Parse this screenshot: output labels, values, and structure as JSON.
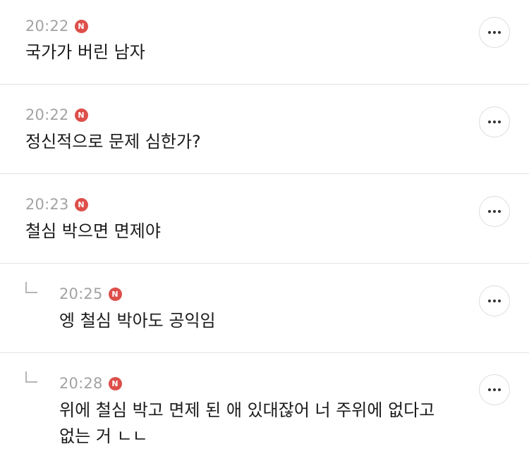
{
  "comments": [
    {
      "time": "20:22",
      "badge": "N",
      "text": "국가가 버린 남자",
      "is_reply": false
    },
    {
      "time": "20:22",
      "badge": "N",
      "text": "정신적으로 문제 심한가?",
      "is_reply": false
    },
    {
      "time": "20:23",
      "badge": "N",
      "text": "철심 박으면 면제야",
      "is_reply": false
    },
    {
      "time": "20:25",
      "badge": "N",
      "text": "엥 철심 박아도 공익임",
      "is_reply": true
    },
    {
      "time": "20:28",
      "badge": "N",
      "text": "위에 철심 박고 면제 된 애 있대잖어 너 주위에 없다고\n없는 거 ㄴㄴ",
      "is_reply": true
    }
  ],
  "icons": {
    "more": "more-options-icon",
    "reply": "reply-arrow-icon"
  },
  "colors": {
    "badge": "#dd4f4a",
    "time": "#a3a3a3",
    "text": "#1b1b1b",
    "divider": "#e3e3e3"
  }
}
